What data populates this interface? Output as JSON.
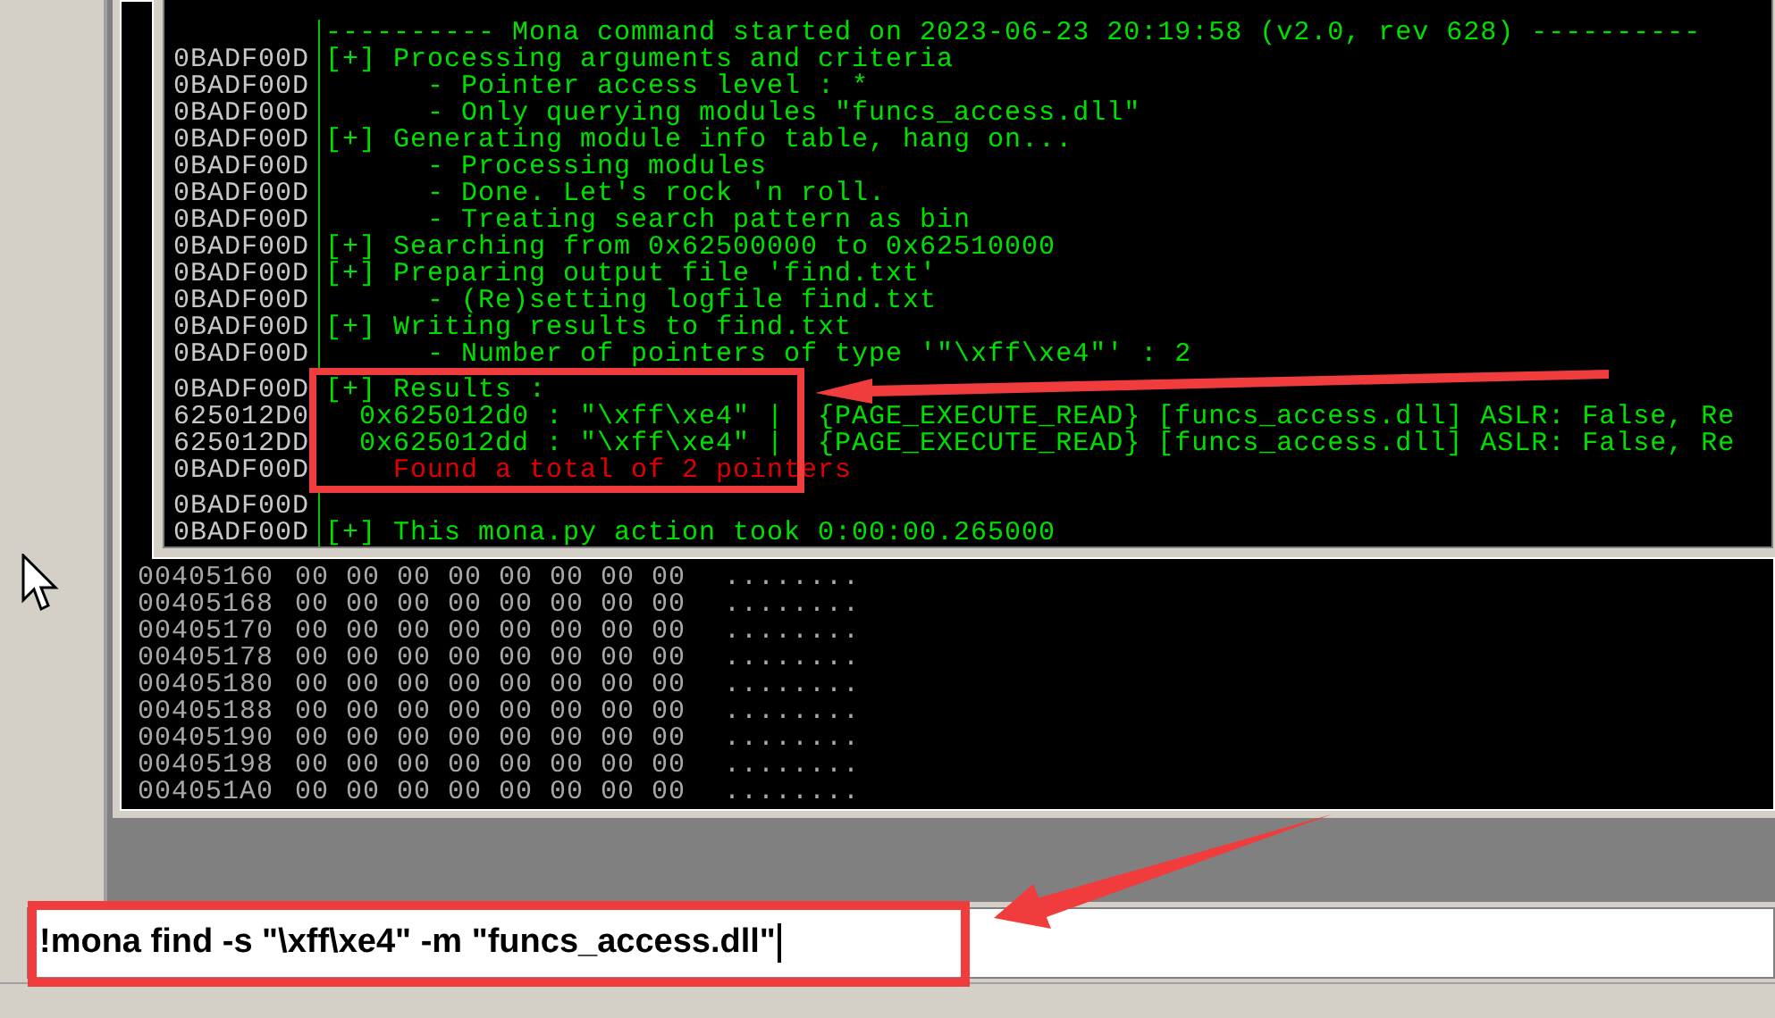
{
  "log_window": {
    "lines": [
      {
        "message": "---------- Mona command started on 2023-06-23 20:19:58 (v2.0, rev 628) ----------",
        "kind": "info",
        "highlighted": false
      },
      {
        "address": "0BADF00D",
        "message": "[+] Processing arguments and criteria",
        "kind": "info",
        "highlighted": false
      },
      {
        "address": "0BADF00D",
        "message": "      - Pointer access level : *",
        "kind": "info",
        "highlighted": false
      },
      {
        "address": "0BADF00D",
        "message": "      - Only querying modules \"funcs_access.dll\"",
        "kind": "info",
        "highlighted": false
      },
      {
        "address": "0BADF00D",
        "message": "[+] Generating module info table, hang on...",
        "kind": "info",
        "highlighted": false
      },
      {
        "address": "0BADF00D",
        "message": "      - Processing modules",
        "kind": "info",
        "highlighted": false
      },
      {
        "address": "0BADF00D",
        "message": "      - Done. Let's rock 'n roll.",
        "kind": "info",
        "highlighted": false
      },
      {
        "address": "0BADF00D",
        "message": "      - Treating search pattern as bin",
        "kind": "info",
        "highlighted": false
      },
      {
        "address": "0BADF00D",
        "message": "[+] Searching from 0x62500000 to 0x62510000",
        "kind": "info",
        "highlighted": false
      },
      {
        "address": "0BADF00D",
        "message": "[+] Preparing output file 'find.txt'",
        "kind": "info",
        "highlighted": false
      },
      {
        "address": "0BADF00D",
        "message": "      - (Re)setting logfile find.txt",
        "kind": "info",
        "highlighted": false
      },
      {
        "address": "0BADF00D",
        "message": "[+] Writing results to find.txt",
        "kind": "info",
        "highlighted": false
      },
      {
        "address": "0BADF00D",
        "message": "      - Number of pointers of type '\"\\xff\\xe4\"' : 2",
        "kind": "info",
        "highlighted": false
      },
      {
        "address": "0BADF00D",
        "message": "[+] Results :",
        "kind": "info",
        "highlighted": true
      },
      {
        "address": "625012D0",
        "message": "  0x625012d0 : \"\\xff\\xe4\" |  {PAGE_EXECUTE_READ} [funcs_access.dll] ASLR: False, Re",
        "kind": "info",
        "highlighted": true
      },
      {
        "address": "625012DD",
        "message": "  0x625012dd : \"\\xff\\xe4\" |  {PAGE_EXECUTE_READ} [funcs_access.dll] ASLR: False, Re",
        "kind": "info",
        "highlighted": true
      },
      {
        "address": "0BADF00D",
        "message": "    Found a total of 2 pointers",
        "kind": "error",
        "highlighted": true
      },
      {
        "address": "0BADF00D",
        "highlighted": false
      },
      {
        "address": "0BADF00D",
        "message": "[+] This mona.py action took 0:00:00.265000",
        "kind": "info",
        "highlighted": false
      }
    ]
  },
  "dump_window": {
    "rows": [
      {
        "address": "00405160",
        "bytes": "00 00 00 00 00 00 00 00",
        "ascii": "........"
      },
      {
        "address": "00405168",
        "bytes": "00 00 00 00 00 00 00 00",
        "ascii": "........"
      },
      {
        "address": "00405170",
        "bytes": "00 00 00 00 00 00 00 00",
        "ascii": "........"
      },
      {
        "address": "00405178",
        "bytes": "00 00 00 00 00 00 00 00",
        "ascii": "........"
      },
      {
        "address": "00405180",
        "bytes": "00 00 00 00 00 00 00 00",
        "ascii": "........"
      },
      {
        "address": "00405188",
        "bytes": "00 00 00 00 00 00 00 00",
        "ascii": "........"
      },
      {
        "address": "00405190",
        "bytes": "00 00 00 00 00 00 00 00",
        "ascii": "........"
      },
      {
        "address": "00405198",
        "bytes": "00 00 00 00 00 00 00 00",
        "ascii": "........"
      },
      {
        "address": "004051A0",
        "bytes": "00 00 00 00 00 00 00 00",
        "ascii": "........"
      }
    ]
  },
  "command_bar": {
    "value": "!mona find -s \"\\xff\\xe4\" -m \"funcs_access.dll\""
  }
}
